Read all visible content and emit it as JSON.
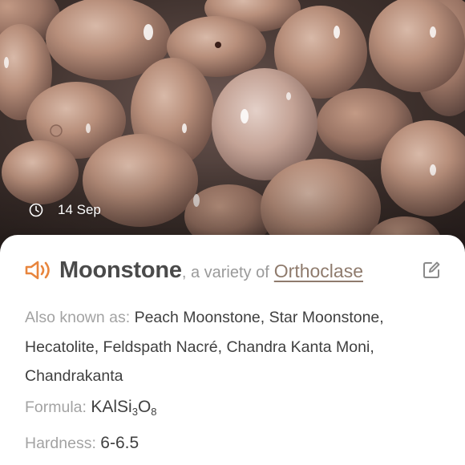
{
  "photo": {
    "icon": "clock-icon",
    "date": "14 Sep"
  },
  "card": {
    "speaker_icon": "speaker-icon",
    "accent_color": "#e8853d",
    "name": "Moonstone",
    "variety_text": ", a variety of",
    "parent_mineral": "Orthoclase",
    "edit_icon": "edit-icon",
    "also_known_as": {
      "label": "Also known as:",
      "value": "Peach Moonstone, Star Moonstone, Hecatolite, Feldspath Nacré, Chandra Kanta Moni, Chandrakanta"
    },
    "formula": {
      "label": "Formula:",
      "prefix": "KAlSi",
      "sub1": "3",
      "mid": "O",
      "sub2": "8"
    },
    "hardness": {
      "label": "Hardness:",
      "value": "6-6.5"
    }
  }
}
